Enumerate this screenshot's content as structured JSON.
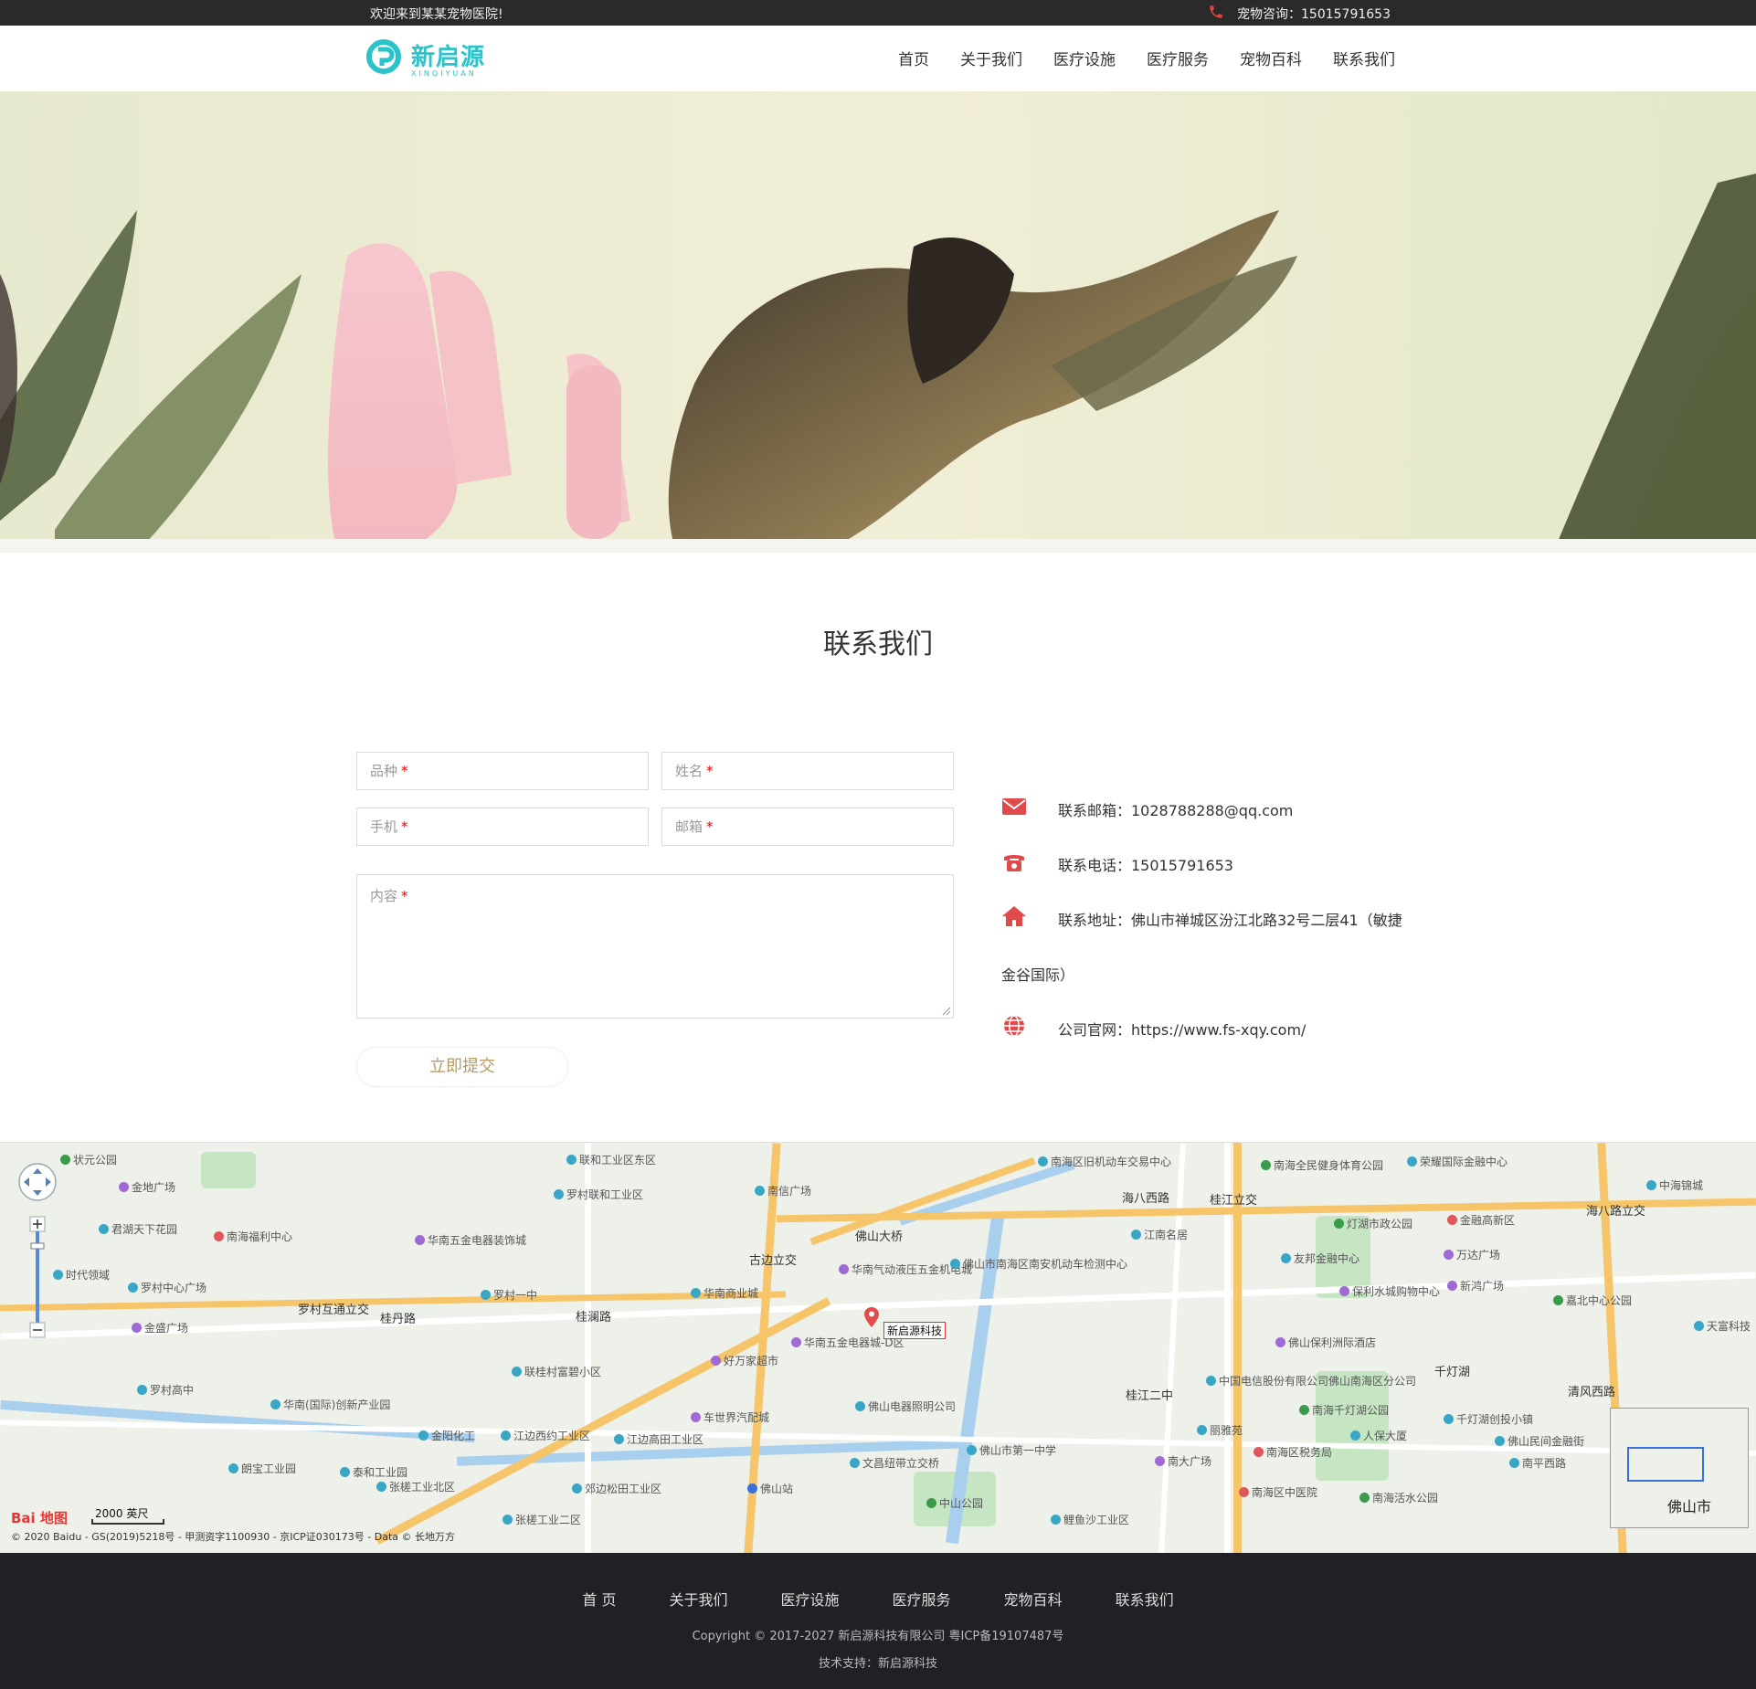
{
  "topbar": {
    "welcome": "欢迎来到某某宠物医院!",
    "consult": "宠物咨询：15015791653"
  },
  "brand": {
    "name": "新启源",
    "sub": "XINQIYUAN",
    "color": "#29c3c9"
  },
  "nav": [
    "首页",
    "关于我们",
    "医疗设施",
    "医疗服务",
    "宠物百科",
    "联系我们"
  ],
  "section": {
    "title": "联系我们"
  },
  "form": {
    "breed": "品种",
    "name": "姓名",
    "phone": "手机",
    "email": "邮箱",
    "content": "内容",
    "required_mark": "*",
    "submit": "立即提交"
  },
  "contact": {
    "email": "联系邮箱：1028788288@qq.com",
    "tel": "联系电话：15015791653",
    "address": "联系地址：佛山市禅城区汾江北路32号二层41（敏捷",
    "address_cont": "金谷国际）",
    "website": "公司官网：https://www.fs-xqy.com/"
  },
  "map": {
    "pin_label": "新启源科技",
    "scale": "2000 英尺",
    "logo": "Bai 地图",
    "copyright": "© 2020 Baidu - GS(2019)5218号 - 甲测资字1100930 - 京ICP证030173号 - Data © 长地万方",
    "overview_city": "佛山市",
    "roads": [
      "海八西路",
      "桂江立交",
      "海八路立交",
      "佛山大桥",
      "罗村互通立交",
      "桂丹路",
      "古边立交",
      "桂澜路",
      "千灯湖",
      "清风西路",
      "桂江二中"
    ],
    "pois": [
      {
        "name": "状元公园",
        "color": "#3a9b4a"
      },
      {
        "name": "金地广场",
        "color": "#a06ad6"
      },
      {
        "name": "君湖天下花园",
        "color": "#3aa6c6"
      },
      {
        "name": "南海福利中心",
        "color": "#e0575b"
      },
      {
        "name": "华南五金电器装饰城",
        "color": "#a06ad6"
      },
      {
        "name": "时代领域",
        "color": "#3aa6c6"
      },
      {
        "name": "罗村中心广场",
        "color": "#3aa6c6"
      },
      {
        "name": "罗村一中",
        "color": "#3aa6c6"
      },
      {
        "name": "金盛广场",
        "color": "#a06ad6"
      },
      {
        "name": "联和工业区东区",
        "color": "#3aa6c6"
      },
      {
        "name": "罗村联和工业区",
        "color": "#3aa6c6"
      },
      {
        "name": "南信广场",
        "color": "#3aa6c6"
      },
      {
        "name": "华南气动液压五金机电城",
        "color": "#a06ad6"
      },
      {
        "name": "华南商业城",
        "color": "#3aa6c6"
      },
      {
        "name": "华南五金电器城-D区",
        "color": "#a06ad6"
      },
      {
        "name": "好万家超市",
        "color": "#a06ad6"
      },
      {
        "name": "车世界汽配城",
        "color": "#a06ad6"
      },
      {
        "name": "佛山电器照明公司",
        "color": "#3aa6c6"
      },
      {
        "name": "文昌纽带立交桥",
        "color": "#3aa6c6"
      },
      {
        "name": "中山公园",
        "color": "#3a9b4a"
      },
      {
        "name": "佛山市第一中学",
        "color": "#3aa6c6"
      },
      {
        "name": "鲤鱼沙工业区",
        "color": "#3aa6c6"
      },
      {
        "name": "南海区旧机动车交易中心",
        "color": "#3aa6c6"
      },
      {
        "name": "江南名居",
        "color": "#3aa6c6"
      },
      {
        "name": "佛山市南海区南安机动车检测中心",
        "color": "#3aa6c6"
      },
      {
        "name": "南海全民健身体育公园",
        "color": "#3a9b4a"
      },
      {
        "name": "灯湖市政公园",
        "color": "#3a9b4a"
      },
      {
        "name": "友邦金融中心",
        "color": "#3aa6c6"
      },
      {
        "name": "保利水城购物中心",
        "color": "#a06ad6"
      },
      {
        "name": "佛山保利洲际酒店",
        "color": "#a06ad6"
      },
      {
        "name": "中国电信股份有限公司佛山南海区分公司",
        "color": "#3aa6c6"
      },
      {
        "name": "南海千灯湖公园",
        "color": "#3a9b4a"
      },
      {
        "name": "丽雅苑",
        "color": "#3aa6c6"
      },
      {
        "name": "南海区税务局",
        "color": "#e0575b"
      },
      {
        "name": "南海区中医院",
        "color": "#e0575b"
      },
      {
        "name": "南海活水公园",
        "color": "#3a9b4a"
      },
      {
        "name": "荣耀国际金融中心",
        "color": "#3aa6c6"
      },
      {
        "name": "金融高新区",
        "color": "#e0575b"
      },
      {
        "name": "万达广场",
        "color": "#a06ad6"
      },
      {
        "name": "新鸿广场",
        "color": "#a06ad6"
      },
      {
        "name": "嘉北中心公园",
        "color": "#3a9b4a"
      },
      {
        "name": "千灯湖创投小镇",
        "color": "#3aa6c6"
      },
      {
        "name": "佛山民间金融街",
        "color": "#3aa6c6"
      },
      {
        "name": "南平西路",
        "color": "#3aa6c6"
      },
      {
        "name": "天富科技",
        "color": "#3aa6c6"
      },
      {
        "name": "中海锦城",
        "color": "#3aa6c6"
      },
      {
        "name": "人保大厦",
        "color": "#3aa6c6"
      },
      {
        "name": "南大广场",
        "color": "#a06ad6"
      },
      {
        "name": "华南(国际)创新产业园",
        "color": "#3aa6c6"
      },
      {
        "name": "金阳化工",
        "color": "#3aa6c6"
      },
      {
        "name": "江边西约工业区",
        "color": "#3aa6c6"
      },
      {
        "name": "江边高田工业区",
        "color": "#3aa6c6"
      },
      {
        "name": "郊边松田工业区",
        "color": "#3aa6c6"
      },
      {
        "name": "张槎工业北区",
        "color": "#3aa6c6"
      },
      {
        "name": "张槎工业二区",
        "color": "#3aa6c6"
      },
      {
        "name": "泰和工业园",
        "color": "#3aa6c6"
      },
      {
        "name": "朗宝工业园",
        "color": "#3aa6c6"
      },
      {
        "name": "罗村高中",
        "color": "#3aa6c6"
      },
      {
        "name": "联桂村富碧小区",
        "color": "#3aa6c6"
      },
      {
        "name": "佛山站",
        "color": "#3b6fd8"
      }
    ]
  },
  "footer": {
    "nav": [
      "首 页",
      "关于我们",
      "医疗设施",
      "医疗服务",
      "宠物百科",
      "联系我们"
    ],
    "copyright": "Copyright © 2017-2027 新启源科技有限公司 粤ICP备19107487号",
    "tech": "技术支持：新启源科技"
  }
}
